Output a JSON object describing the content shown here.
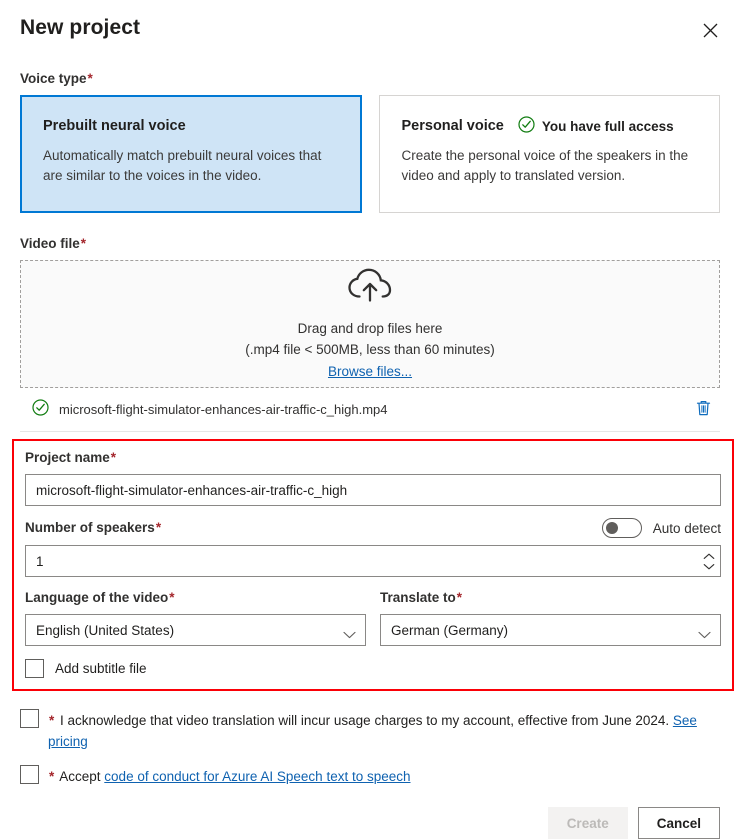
{
  "dialog": {
    "title": "New project",
    "close_label": "Close"
  },
  "voice_type": {
    "label": "Voice type",
    "required_mark": "*",
    "cards": [
      {
        "title": "Prebuilt neural voice",
        "description": "Automatically match prebuilt neural voices that are similar to the voices in the video.",
        "selected": true
      },
      {
        "title": "Personal voice",
        "badge": "You have full access",
        "description": "Create the personal voice of the speakers in the video and apply to translated version.",
        "selected": false
      }
    ]
  },
  "video_file": {
    "label": "Video file",
    "required_mark": "*",
    "drop_title": "Drag and drop files here",
    "drop_hint": "(.mp4 file < 500MB, less than 60 minutes)",
    "browse_link": "Browse files...",
    "uploaded": {
      "name": "microsoft-flight-simulator-enhances-air-traffic-c_high.mp4",
      "delete_label": "Delete file"
    }
  },
  "form": {
    "project_name": {
      "label": "Project name",
      "required_mark": "*",
      "value": "microsoft-flight-simulator-enhances-air-traffic-c_high",
      "placeholder": "Enter project name"
    },
    "speakers": {
      "label": "Number of speakers",
      "required_mark": "*",
      "value": "1",
      "auto_detect_label": "Auto detect",
      "auto_detect_on": false
    },
    "source_language": {
      "label": "Language of the video",
      "required_mark": "*",
      "value": "English (United States)"
    },
    "target_language": {
      "label": "Translate to",
      "required_mark": "*",
      "value": "German (Germany)"
    },
    "subtitle": {
      "label": "Add subtitle file",
      "checked": false
    },
    "highlight_color": "#fb0007"
  },
  "consents": [
    {
      "required_mark": "*",
      "text_before": " I acknowledge that video translation will incur usage charges to my account, effective from June 2024. ",
      "link": "See pricing",
      "text_after": "",
      "checked": false
    },
    {
      "required_mark": "*",
      "text_before": " Accept ",
      "link": "code of conduct for Azure AI Speech text to speech",
      "text_after": "",
      "checked": false
    }
  ],
  "footer": {
    "create_label": "Create",
    "create_disabled": true,
    "cancel_label": "Cancel"
  },
  "colors": {
    "accent": "#0078d4",
    "selected_card_bg": "#cfe4f6",
    "required": "#a4262c",
    "link": "#0f62b0",
    "success": "#107c10",
    "highlight": "#fb0007",
    "trash": "#0f6cbd"
  }
}
